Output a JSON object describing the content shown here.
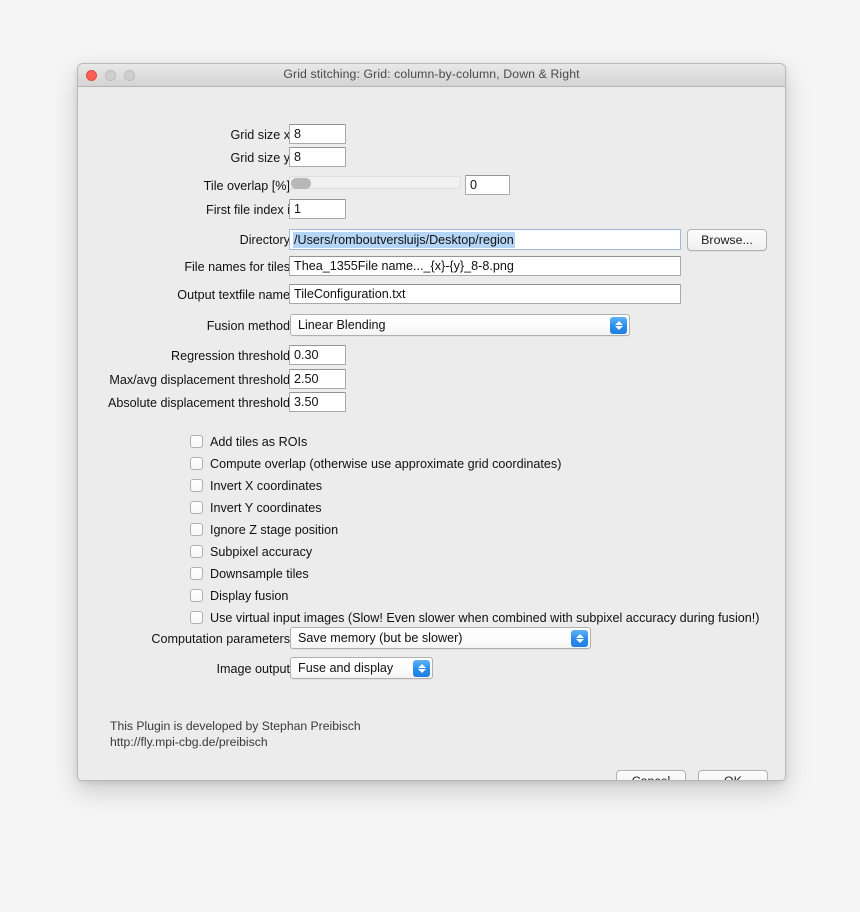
{
  "window": {
    "title": "Grid stitching: Grid: column-by-column, Down & Right",
    "traffic_lights": [
      "close-button",
      "minimize-button",
      "zoom-button"
    ]
  },
  "fields": {
    "grid_size_x": {
      "label": "Grid size x",
      "value": "8"
    },
    "grid_size_y": {
      "label": "Grid size y",
      "value": "8"
    },
    "tile_overlap": {
      "label": "Tile overlap [%]",
      "value": "0"
    },
    "first_file_index": {
      "label": "First file index i",
      "value": "1"
    },
    "directory": {
      "label": "Directory",
      "value": "/Users/romboutversluijs/Desktop/region",
      "browse_label": "Browse..."
    },
    "file_names": {
      "label": "File names for tiles",
      "value": "Thea_1355File name..._{x}-{y}_8-8.png"
    },
    "output_textfile": {
      "label": "Output textfile name",
      "value": "TileConfiguration.txt"
    },
    "fusion_method": {
      "label": "Fusion method",
      "value": "Linear Blending"
    },
    "regression_threshold": {
      "label": "Regression threshold",
      "value": "0.30"
    },
    "max_avg_displacement": {
      "label": "Max/avg displacement threshold",
      "value": "2.50"
    },
    "absolute_displacement": {
      "label": "Absolute displacement threshold",
      "value": "3.50"
    },
    "computation_parameters": {
      "label": "Computation parameters",
      "value": "Save memory (but be slower)"
    },
    "image_output": {
      "label": "Image output",
      "value": "Fuse and display"
    }
  },
  "checkboxes": [
    {
      "label": "Add tiles as ROIs",
      "checked": false
    },
    {
      "label": "Compute overlap (otherwise use approximate grid coordinates)",
      "checked": false
    },
    {
      "label": "Invert X coordinates",
      "checked": false
    },
    {
      "label": "Invert Y coordinates",
      "checked": false
    },
    {
      "label": "Ignore Z stage position",
      "checked": false
    },
    {
      "label": "Subpixel accuracy",
      "checked": false
    },
    {
      "label": "Downsample tiles",
      "checked": false
    },
    {
      "label": "Display fusion",
      "checked": false
    },
    {
      "label": "Use virtual input images (Slow! Even slower when combined with subpixel accuracy during fusion!)",
      "checked": false
    }
  ],
  "credits": {
    "line1": "This Plugin is developed by Stephan Preibisch",
    "line2": "http://fly.mpi-cbg.de/preibisch"
  },
  "buttons": {
    "cancel": "Cancel",
    "ok": "OK"
  },
  "colors": {
    "window_bg": "#ececec",
    "selection_blue": "#b4d5f5",
    "accent_blue": "#2c8fee",
    "close_red": "#fc6055"
  }
}
